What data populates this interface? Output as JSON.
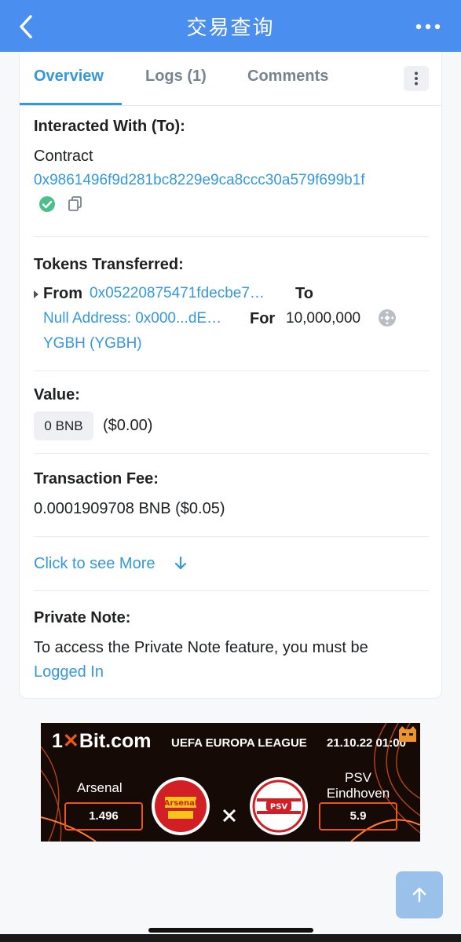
{
  "header": {
    "title": "交易查询"
  },
  "tabs": [
    {
      "label": "Overview"
    },
    {
      "label": "Logs (1)"
    },
    {
      "label": "Comments"
    }
  ],
  "interacted": {
    "label": "Interacted With (To):",
    "type": "Contract",
    "address": "0x9861496f9d281bc8229e9ca8ccc30a579f699b1f"
  },
  "tokens": {
    "label": "Tokens Transferred:",
    "from_label": "From",
    "from_address": "0x05220875471fdecbe7…",
    "to_label": "To",
    "to_address": "Null Address: 0x000...dE…",
    "for_label": "For",
    "amount": "10,000,000",
    "token": "YGBH (YGBH)"
  },
  "value": {
    "label": "Value:",
    "badge": "0 BNB",
    "usd": "($0.00)"
  },
  "fee": {
    "label": "Transaction Fee:",
    "amount": "0.0001909708 BNB ($0.05)"
  },
  "more": {
    "label": "Click to see More"
  },
  "note": {
    "label": "Private Note:",
    "text": "To access the Private Note feature, you must be",
    "link": "Logged In"
  },
  "ad": {
    "brand_prefix": "1",
    "brand_mid": "Bit.com",
    "league": "UEFA EUROPA LEAGUE",
    "datetime": "21.10.22 01:00",
    "team1": "Arsenal",
    "odds1": "1.496",
    "team2_line1": "PSV",
    "team2_line2": "Eindhoven",
    "odds2": "5.9",
    "crest1_text": "Arsenal",
    "crest2_text": "PSV"
  },
  "colors": {
    "header": "#4a8ef0",
    "link": "#3498db",
    "success": "#4bbf8c"
  }
}
